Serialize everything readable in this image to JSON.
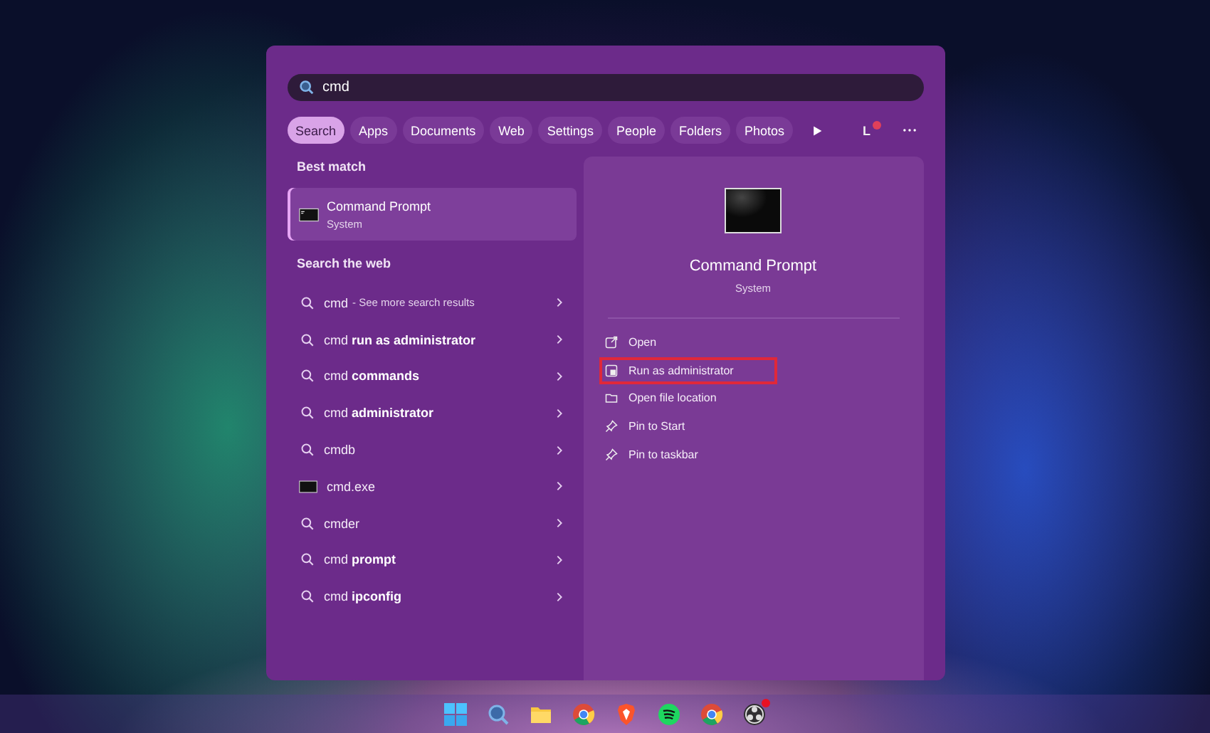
{
  "search": {
    "value": "cmd"
  },
  "tabs": [
    {
      "label": "Search",
      "selected": true
    },
    {
      "label": "Apps",
      "selected": false
    },
    {
      "label": "Documents",
      "selected": false
    },
    {
      "label": "Web",
      "selected": false
    },
    {
      "label": "Settings",
      "selected": false
    },
    {
      "label": "People",
      "selected": false
    },
    {
      "label": "Folders",
      "selected": false
    },
    {
      "label": "Photos",
      "selected": false
    }
  ],
  "account": {
    "initial": "L",
    "notification": true
  },
  "best_match": {
    "heading": "Best match",
    "title": "Command Prompt",
    "subtitle": "System",
    "selected": true
  },
  "web": {
    "heading": "Search the web",
    "results": [
      {
        "kind": "search",
        "text": "cmd",
        "note": "- See more search results"
      },
      {
        "kind": "search",
        "text": "cmd **run as administrator**"
      },
      {
        "kind": "search",
        "text": "cmd **commands**"
      },
      {
        "kind": "search",
        "text": "cmd **administrator**"
      },
      {
        "kind": "search",
        "text": "cmdb"
      },
      {
        "kind": "app",
        "text": "cmd.exe"
      },
      {
        "kind": "search",
        "text": "cmder"
      },
      {
        "kind": "search",
        "text": "cmd **prompt**"
      },
      {
        "kind": "search",
        "text": "cmd **ipconfig**"
      }
    ]
  },
  "detail": {
    "title": "Command Prompt",
    "subtitle": "System",
    "actions": [
      {
        "kind": "open",
        "label": "Open",
        "highlighted": false
      },
      {
        "kind": "admin",
        "label": "Run as administrator",
        "highlighted": true
      },
      {
        "kind": "folder",
        "label": "Open file location",
        "highlighted": false
      },
      {
        "kind": "pin",
        "label": "Pin to Start",
        "highlighted": false
      },
      {
        "kind": "pin",
        "label": "Pin to taskbar",
        "highlighted": false
      }
    ]
  },
  "taskbar": [
    {
      "kind": "start",
      "notification": false
    },
    {
      "kind": "search",
      "notification": false
    },
    {
      "kind": "folder",
      "notification": false
    },
    {
      "kind": "chrome",
      "notification": false
    },
    {
      "kind": "shield",
      "notification": false
    },
    {
      "kind": "music",
      "notification": false
    },
    {
      "kind": "chrome",
      "notification": false
    },
    {
      "kind": "record",
      "notification": true
    }
  ]
}
